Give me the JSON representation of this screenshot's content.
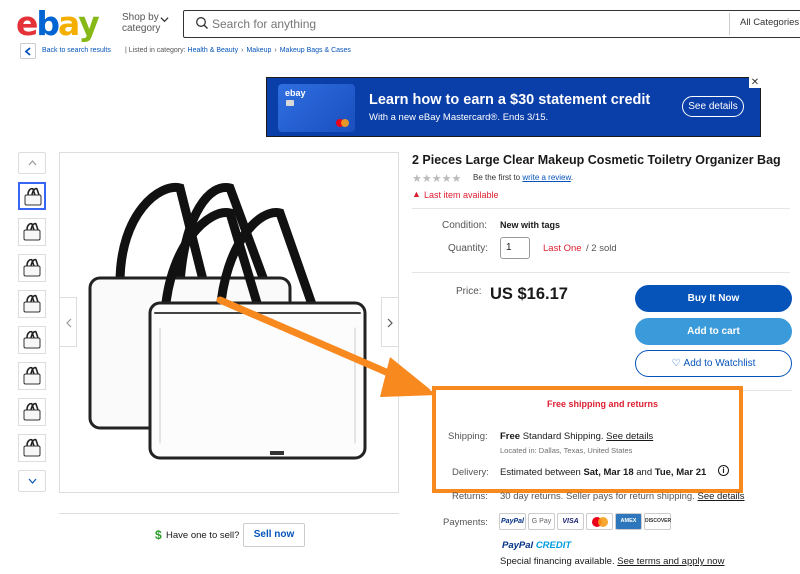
{
  "header": {
    "logo_letters": [
      "e",
      "b",
      "a",
      "y"
    ],
    "logo_colors": [
      "#e53238",
      "#0064d2",
      "#f5af02",
      "#86b817"
    ],
    "shop_by_category": "Shop by category",
    "search_placeholder": "Search for anything",
    "category_select": "All Categories"
  },
  "breadcrumb": {
    "back": "Back to search results",
    "listed_in": "Listed in category:",
    "items": [
      "Health & Beauty",
      "Makeup",
      "Makeup Bags & Cases"
    ]
  },
  "banner": {
    "card_logo": "ebay",
    "title": "Learn how to earn a $30 statement credit",
    "subtitle": "With a new eBay Mastercard®. Ends 3/15.",
    "button": "See details",
    "close": "✕"
  },
  "product": {
    "title": "2 Pieces Large Clear Makeup Cosmetic Toiletry Organizer Bag",
    "rating_prefix": "Be the first to",
    "rating_link": "write a review",
    "rating_suffix": ".",
    "last_item": "Last item available",
    "condition_label": "Condition:",
    "condition_value": "New with tags",
    "quantity_label": "Quantity:",
    "quantity_value": "1",
    "last_one": "Last One",
    "sold": "/ 2 sold",
    "price_label": "Price:",
    "price_value": "US $16.17"
  },
  "actions": {
    "buy_now": "Buy It Now",
    "add_to_cart": "Add to cart",
    "watchlist": "Add to Watchlist"
  },
  "shipping": {
    "free_banner": "Free shipping and returns",
    "shipping_label": "Shipping:",
    "shipping_free": "Free",
    "shipping_method": "Standard Shipping.",
    "shipping_link": "See details",
    "location": "Located in: Dallas, Texas, United States",
    "delivery_label": "Delivery:",
    "delivery_prefix": "Estimated between",
    "delivery_start": "Sat, Mar 18",
    "delivery_and": "and",
    "delivery_end": "Tue, Mar 21",
    "returns_label": "Returns:",
    "returns_text": "30 day returns. Seller pays for return shipping.",
    "returns_link": "See details",
    "payments_label": "Payments:",
    "payment_methods": [
      "PayPal",
      "G Pay",
      "VISA",
      "Mastercard",
      "AMEX",
      "DISCOVER"
    ],
    "paypal_credit_a": "PayPal",
    "paypal_credit_b": "CREDIT",
    "financing_text": "Special financing available.",
    "financing_link": "See terms and apply now"
  },
  "sell": {
    "dollar": "$",
    "prompt": "Have one to sell?",
    "button": "Sell now"
  },
  "colors": {
    "accent": "#0654ba",
    "cart": "#3b9ad9",
    "alert": "#dd1e31",
    "highlight": "#f7891f"
  }
}
